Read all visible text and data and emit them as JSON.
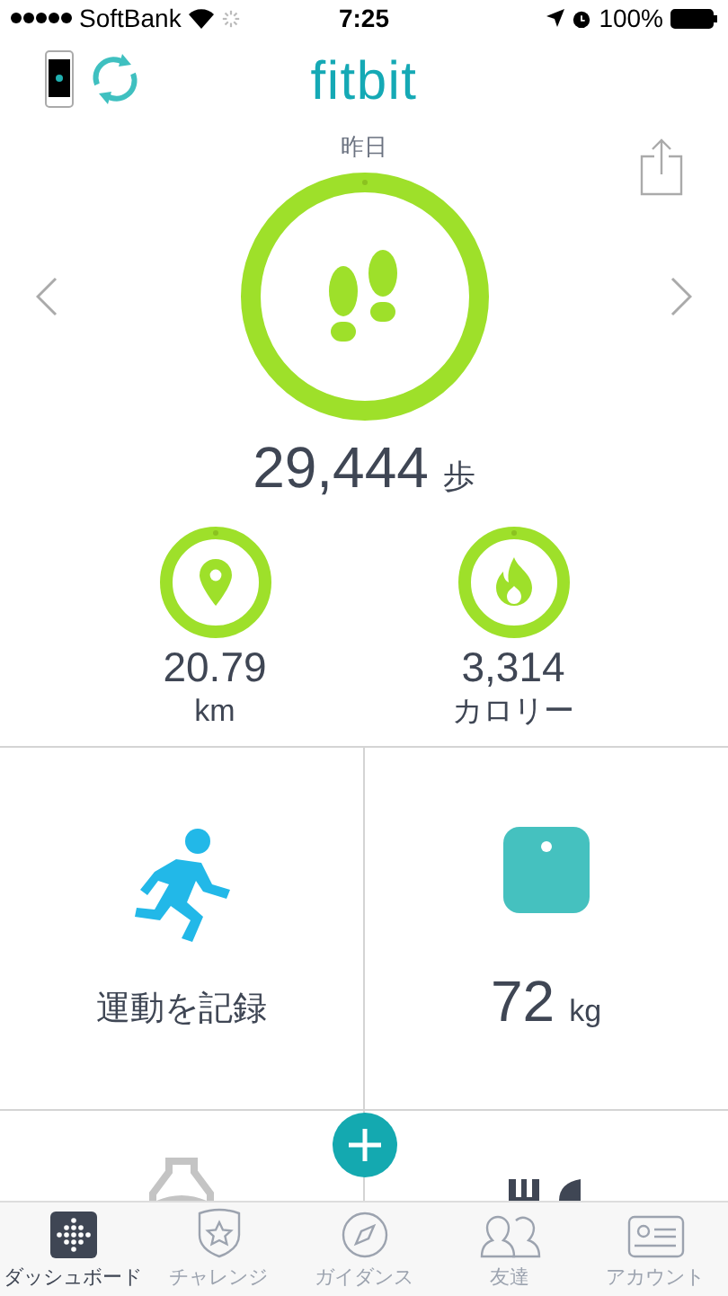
{
  "status_bar": {
    "carrier": "SoftBank",
    "time": "7:25",
    "battery": "100%"
  },
  "header": {
    "logo": "fitbit"
  },
  "day": "昨日",
  "steps": {
    "value": "29,444",
    "unit": "歩"
  },
  "stats": [
    {
      "kind": "distance",
      "value": "20.79",
      "unit": "km"
    },
    {
      "kind": "calories",
      "value": "3,314",
      "unit": "カロリー"
    }
  ],
  "tiles": [
    {
      "kind": "exercise",
      "label": "運動を記録"
    },
    {
      "kind": "weight",
      "value": "72",
      "unit": "kg"
    }
  ],
  "tabs": [
    {
      "label": "ダッシュボード",
      "kind": "dashboard",
      "selected": true
    },
    {
      "label": "チャレンジ",
      "kind": "challenge",
      "selected": false
    },
    {
      "label": "ガイダンス",
      "kind": "guidance",
      "selected": false
    },
    {
      "label": "友達",
      "kind": "friends",
      "selected": false
    },
    {
      "label": "アカウント",
      "kind": "account",
      "selected": false
    }
  ]
}
